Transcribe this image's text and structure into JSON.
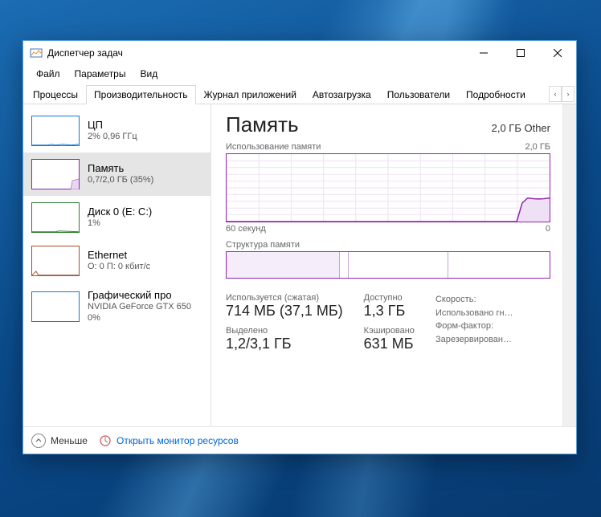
{
  "window": {
    "title": "Диспетчер задач"
  },
  "menu": {
    "file": "Файл",
    "options": "Параметры",
    "view": "Вид"
  },
  "tabs": {
    "processes": "Процессы",
    "performance": "Производительность",
    "app_history": "Журнал приложений",
    "startup": "Автозагрузка",
    "users": "Пользователи",
    "details": "Подробности",
    "scroll_left": "‹",
    "scroll_right": "›"
  },
  "sidebar": {
    "cpu": {
      "title": "ЦП",
      "sub": "2% 0,96 ГГц"
    },
    "memory": {
      "title": "Память",
      "sub": "0,7/2,0 ГБ (35%)"
    },
    "disk": {
      "title": "Диск 0 (E: C:)",
      "sub": "1%"
    },
    "eth": {
      "title": "Ethernet",
      "sub": "О: 0 П: 0 кбит/с"
    },
    "gpu": {
      "title": "Графический про",
      "sub": "NVIDIA GeForce GTX 650",
      "extra": "0%"
    }
  },
  "detail": {
    "title": "Память",
    "capacity": "2,0 ГБ Other",
    "usage_label": "Использование памяти",
    "usage_max": "2,0 ГБ",
    "axis_left": "60 секунд",
    "axis_right": "0",
    "structure_label": "Структура памяти",
    "stats": {
      "in_use_label": "Используется (сжатая)",
      "in_use_value": "714 МБ (37,1 МБ)",
      "available_label": "Доступно",
      "available_value": "1,3 ГБ",
      "committed_label": "Выделено",
      "committed_value": "1,2/3,1 ГБ",
      "cached_label": "Кэшировано",
      "cached_value": "631 МБ"
    },
    "info": {
      "speed": "Скорость:",
      "slots": "Использовано гн…",
      "form": "Форм-фактор:",
      "reserved": "Зарезервирован…"
    }
  },
  "footer": {
    "fewer": "Меньше",
    "resmon": "Открыть монитор ресурсов"
  },
  "chart_data": {
    "type": "area",
    "title": "Использование памяти",
    "xlabel": "60 секунд",
    "ylabel": "",
    "ylim": [
      0,
      2.0
    ],
    "y_unit": "ГБ",
    "x_seconds": 60,
    "series": [
      {
        "name": "Память",
        "values": [
          0.0,
          0.0,
          0.0,
          0.0,
          0.0,
          0.0,
          0.0,
          0.0,
          0.0,
          0.0,
          0.0,
          0.0,
          0.0,
          0.0,
          0.0,
          0.0,
          0.0,
          0.0,
          0.0,
          0.0,
          0.0,
          0.0,
          0.0,
          0.0,
          0.0,
          0.0,
          0.0,
          0.0,
          0.0,
          0.0,
          0.0,
          0.0,
          0.0,
          0.0,
          0.0,
          0.0,
          0.0,
          0.0,
          0.0,
          0.0,
          0.0,
          0.0,
          0.0,
          0.0,
          0.0,
          0.0,
          0.0,
          0.0,
          0.0,
          0.0,
          0.0,
          0.0,
          0.0,
          0.0,
          0.55,
          0.7,
          0.68,
          0.67,
          0.68,
          0.7
        ]
      }
    ],
    "memory_composition": {
      "total_gb": 2.0,
      "in_use_gb": 0.7,
      "modified_gb": 0.05,
      "standby_gb": 0.62,
      "free_gb": 0.63
    }
  }
}
